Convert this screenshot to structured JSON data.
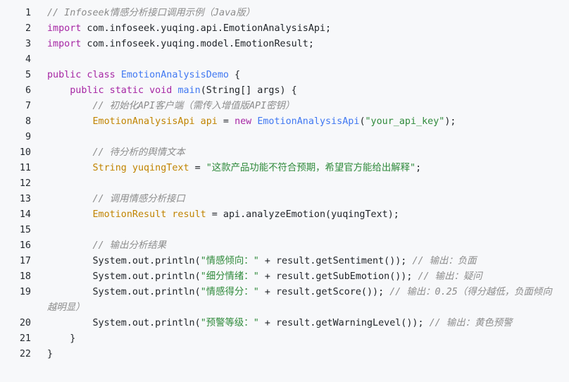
{
  "lines": [
    {
      "n": "1",
      "indent": "",
      "parts": [
        {
          "t": "cm",
          "v": "// Infoseek情感分析接口调用示例（Java版）"
        }
      ]
    },
    {
      "n": "2",
      "indent": "",
      "parts": [
        {
          "t": "kw",
          "v": "import"
        },
        {
          "t": "pl",
          "v": " com.infoseek.yuqing.api.EmotionAnalysisApi;"
        }
      ]
    },
    {
      "n": "3",
      "indent": "",
      "parts": [
        {
          "t": "kw",
          "v": "import"
        },
        {
          "t": "pl",
          "v": " com.infoseek.yuqing.model.EmotionResult;"
        }
      ]
    },
    {
      "n": "4",
      "indent": "",
      "parts": []
    },
    {
      "n": "5",
      "indent": "",
      "parts": [
        {
          "t": "kw",
          "v": "public class"
        },
        {
          "t": "pl",
          "v": " "
        },
        {
          "t": "fn",
          "v": "EmotionAnalysisDemo"
        },
        {
          "t": "pl",
          "v": " {"
        }
      ]
    },
    {
      "n": "6",
      "indent": "    ",
      "parts": [
        {
          "t": "kw",
          "v": "public static void"
        },
        {
          "t": "pl",
          "v": " "
        },
        {
          "t": "fn",
          "v": "main"
        },
        {
          "t": "pl",
          "v": "(String[] args) {"
        }
      ]
    },
    {
      "n": "7",
      "indent": "        ",
      "parts": [
        {
          "t": "cm",
          "v": "// 初始化API客户端（需传入增值版API密钥）"
        }
      ]
    },
    {
      "n": "8",
      "indent": "        ",
      "parts": [
        {
          "t": "ty",
          "v": "EmotionAnalysisApi api"
        },
        {
          "t": "pl",
          "v": " = "
        },
        {
          "t": "kw",
          "v": "new"
        },
        {
          "t": "pl",
          "v": " "
        },
        {
          "t": "fn",
          "v": "EmotionAnalysisApi"
        },
        {
          "t": "pl",
          "v": "("
        },
        {
          "t": "st",
          "v": "\"your_api_key\""
        },
        {
          "t": "pl",
          "v": ");"
        }
      ]
    },
    {
      "n": "9",
      "indent": "",
      "parts": []
    },
    {
      "n": "10",
      "indent": "        ",
      "parts": [
        {
          "t": "cm",
          "v": "// 待分析的舆情文本"
        }
      ]
    },
    {
      "n": "11",
      "indent": "        ",
      "parts": [
        {
          "t": "ty",
          "v": "String yuqingText"
        },
        {
          "t": "pl",
          "v": " = "
        },
        {
          "t": "st",
          "v": "\"这款产品功能不符合预期，希望官方能给出解释\""
        },
        {
          "t": "pl",
          "v": ";"
        }
      ]
    },
    {
      "n": "12",
      "indent": "",
      "parts": []
    },
    {
      "n": "13",
      "indent": "        ",
      "parts": [
        {
          "t": "cm",
          "v": "// 调用情感分析接口"
        }
      ]
    },
    {
      "n": "14",
      "indent": "        ",
      "parts": [
        {
          "t": "ty",
          "v": "EmotionResult result"
        },
        {
          "t": "pl",
          "v": " = api.analyzeEmotion(yuqingText);"
        }
      ]
    },
    {
      "n": "15",
      "indent": "",
      "parts": []
    },
    {
      "n": "16",
      "indent": "        ",
      "parts": [
        {
          "t": "cm",
          "v": "// 输出分析结果"
        }
      ]
    },
    {
      "n": "17",
      "indent": "        ",
      "parts": [
        {
          "t": "pl",
          "v": "System.out.println("
        },
        {
          "t": "st",
          "v": "\"情感倾向：\""
        },
        {
          "t": "pl",
          "v": " + result.getSentiment()); "
        },
        {
          "t": "cm",
          "v": "// 输出：负面"
        }
      ]
    },
    {
      "n": "18",
      "indent": "        ",
      "parts": [
        {
          "t": "pl",
          "v": "System.out.println("
        },
        {
          "t": "st",
          "v": "\"细分情绪：\""
        },
        {
          "t": "pl",
          "v": " + result.getSubEmotion()); "
        },
        {
          "t": "cm",
          "v": "// 输出：疑问"
        }
      ]
    },
    {
      "n": "19",
      "indent": "        ",
      "parts": [
        {
          "t": "pl",
          "v": "System.out.println("
        },
        {
          "t": "st",
          "v": "\"情感得分：\""
        },
        {
          "t": "pl",
          "v": " + result.getScore()); "
        },
        {
          "t": "cm",
          "v": "// 输出：0.25（得分越低，负面倾向"
        }
      ]
    },
    {
      "n": "",
      "indent": "",
      "parts": [
        {
          "t": "cm",
          "v": "越明显）"
        }
      ],
      "wrap": true
    },
    {
      "n": "20",
      "indent": "        ",
      "parts": [
        {
          "t": "pl",
          "v": "System.out.println("
        },
        {
          "t": "st",
          "v": "\"预警等级：\""
        },
        {
          "t": "pl",
          "v": " + result.getWarningLevel()); "
        },
        {
          "t": "cm",
          "v": "// 输出：黄色预警"
        }
      ]
    },
    {
      "n": "21",
      "indent": "    ",
      "parts": [
        {
          "t": "pl",
          "v": "}"
        }
      ]
    },
    {
      "n": "22",
      "indent": "",
      "parts": [
        {
          "t": "pl",
          "v": "}"
        }
      ]
    }
  ]
}
